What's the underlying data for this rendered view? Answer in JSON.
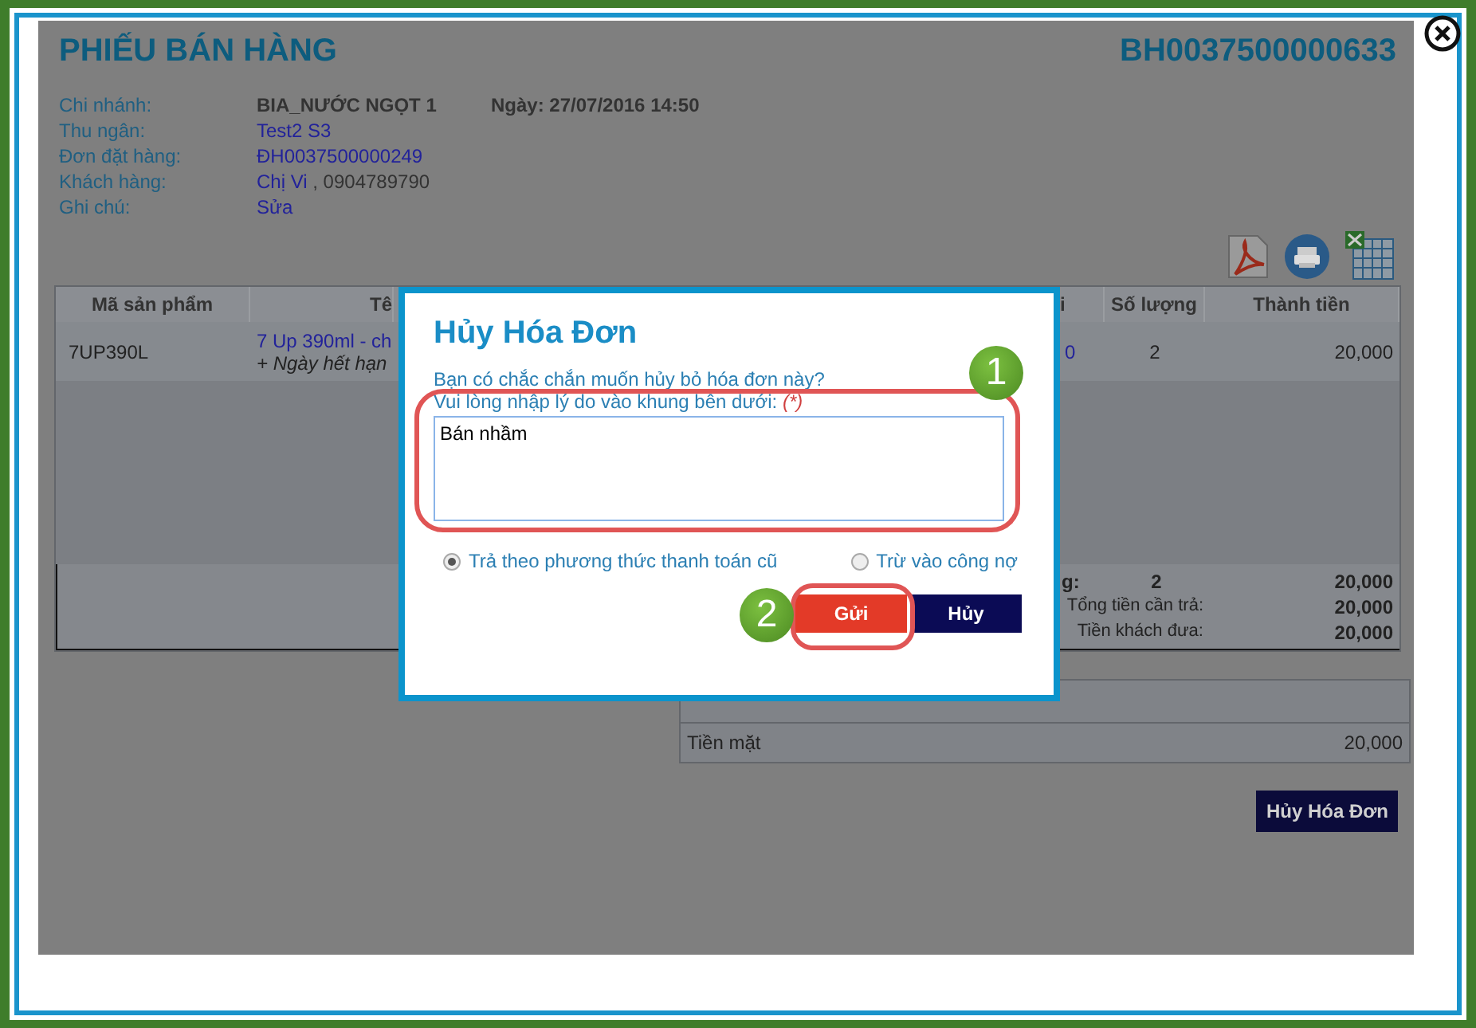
{
  "invoice": {
    "title": "PHIẾU BÁN HÀNG",
    "number": "BH0037500000633",
    "date": "Ngày: 27/07/2016 14:50",
    "info": [
      {
        "label": "Chi nhánh:",
        "value": "BIA_NƯỚC NGỌT 1",
        "kind": "plain"
      },
      {
        "label": "Thu ngân:",
        "value": "Test2 S3",
        "kind": "link"
      },
      {
        "label": "Đơn đặt hàng:",
        "value": "ĐH0037500000249",
        "kind": "link"
      },
      {
        "label": "Khách hàng:",
        "value": "Chị Vi",
        "kind": "link",
        "suffix": " , 0904789790"
      },
      {
        "label": "Ghi chú:",
        "value": "Sửa",
        "kind": "link"
      }
    ],
    "table": {
      "columns": [
        "Mã sản phẩm",
        "Tê",
        "i",
        "Số lượng",
        "Thành tiền"
      ],
      "rows": [
        {
          "code": "7UP390L",
          "name": "7 Up 390ml - ch",
          "note": "+ Ngày hết hạn",
          "price": "0",
          "quantity": "2",
          "total": "20,000"
        }
      ],
      "summary": [
        {
          "label": "g:",
          "quantity": "2",
          "value": "20,000"
        },
        {
          "label": "Tổng tiền cần trả:",
          "value": "20,000"
        },
        {
          "label": "Tiền khách đưa:",
          "value": "20,000"
        }
      ]
    },
    "payments": [
      {
        "method": "Tiền mặt",
        "amount": "20,000"
      }
    ],
    "cancel_button": "Hủy Hóa Đơn"
  },
  "dialog": {
    "title": "Hủy Hóa Đơn",
    "question": "Bạn có chắc chắn muốn hủy bỏ hóa đơn này?",
    "prompt": "Vui lòng nhập lý do vào khung bên dưới:",
    "required_mark": "(*)",
    "reason": "Bán nhầm",
    "options": [
      {
        "label": "Trả theo phương thức thanh toán cũ",
        "selected": true
      },
      {
        "label": "Trừ vào công nợ",
        "selected": false
      }
    ],
    "buttons": [
      {
        "label": "Gửi",
        "kind": "primary"
      },
      {
        "label": "Hủy",
        "kind": "secondary"
      }
    ]
  },
  "annotations": [
    {
      "label": "1"
    },
    {
      "label": "2"
    }
  ]
}
